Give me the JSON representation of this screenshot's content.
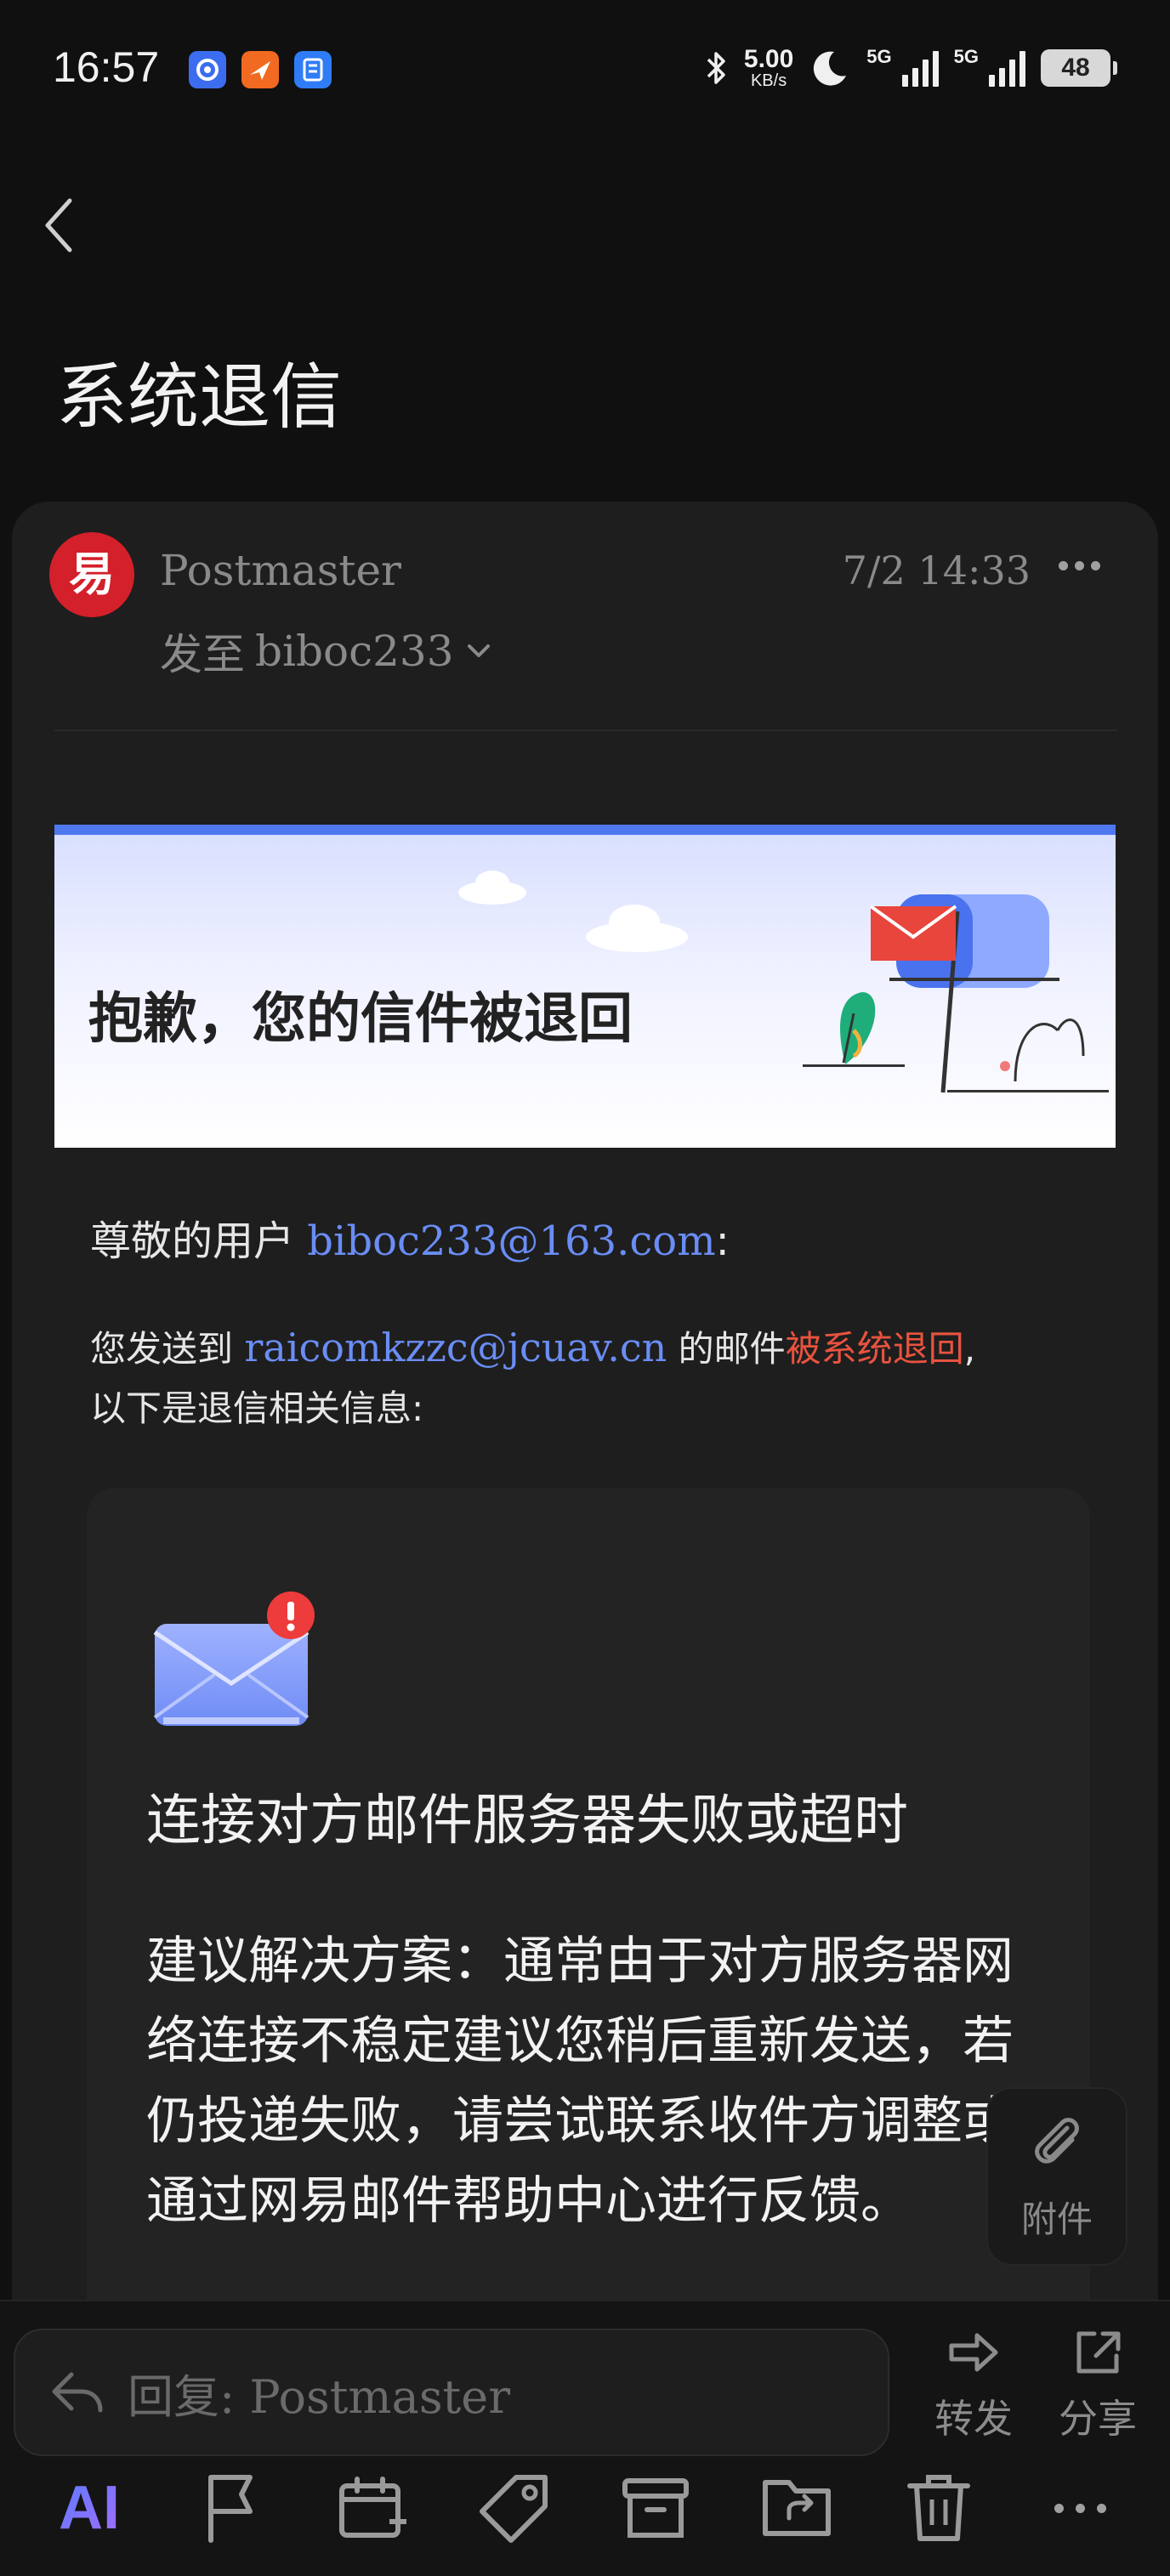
{
  "status_bar": {
    "time": "16:57",
    "network_speed": "5.00",
    "network_speed_unit": "KB/s",
    "network_label_1": "5G",
    "network_label_2": "5G",
    "battery": "48"
  },
  "header": {
    "title": "系统退信"
  },
  "email": {
    "sender_avatar": "易",
    "sender": "Postmaster",
    "date": "7/2 14:33",
    "to_label": "发至",
    "to": "biboc233"
  },
  "banner": {
    "text": "抱歉，您的信件被退回"
  },
  "body": {
    "greeting_prefix": "尊敬的用户",
    "greeting_email": "biboc233@163.com",
    "greeting_suffix": ":",
    "sent_prefix": "您发送到",
    "sent_email": "raicomkzzc@jcuav.cn",
    "sent_middle": "的邮件",
    "sent_highlight": "被系统退回",
    "sent_suffix": ",",
    "info_line": "以下是退信相关信息:"
  },
  "failure": {
    "title": "连接对方邮件服务器失败或超时",
    "suggestion": "建议解决方案：通常由于对方服务器网络连接不稳定建议您稍后重新发送，若仍投递失败，请尝试联系收件方调整或通过网易邮件帮助中心进行反馈。"
  },
  "attachment": {
    "label": "附件"
  },
  "reply": {
    "placeholder": "回复: Postmaster"
  },
  "actions": {
    "forward": "转发",
    "share": "分享"
  },
  "toolbar": {
    "ai_label": "AI"
  },
  "colors": {
    "accent_blue": "#6a8df5",
    "highlight_red": "#e8533f",
    "avatar_red": "#d3202a",
    "banner_bar": "#4f78f0"
  }
}
